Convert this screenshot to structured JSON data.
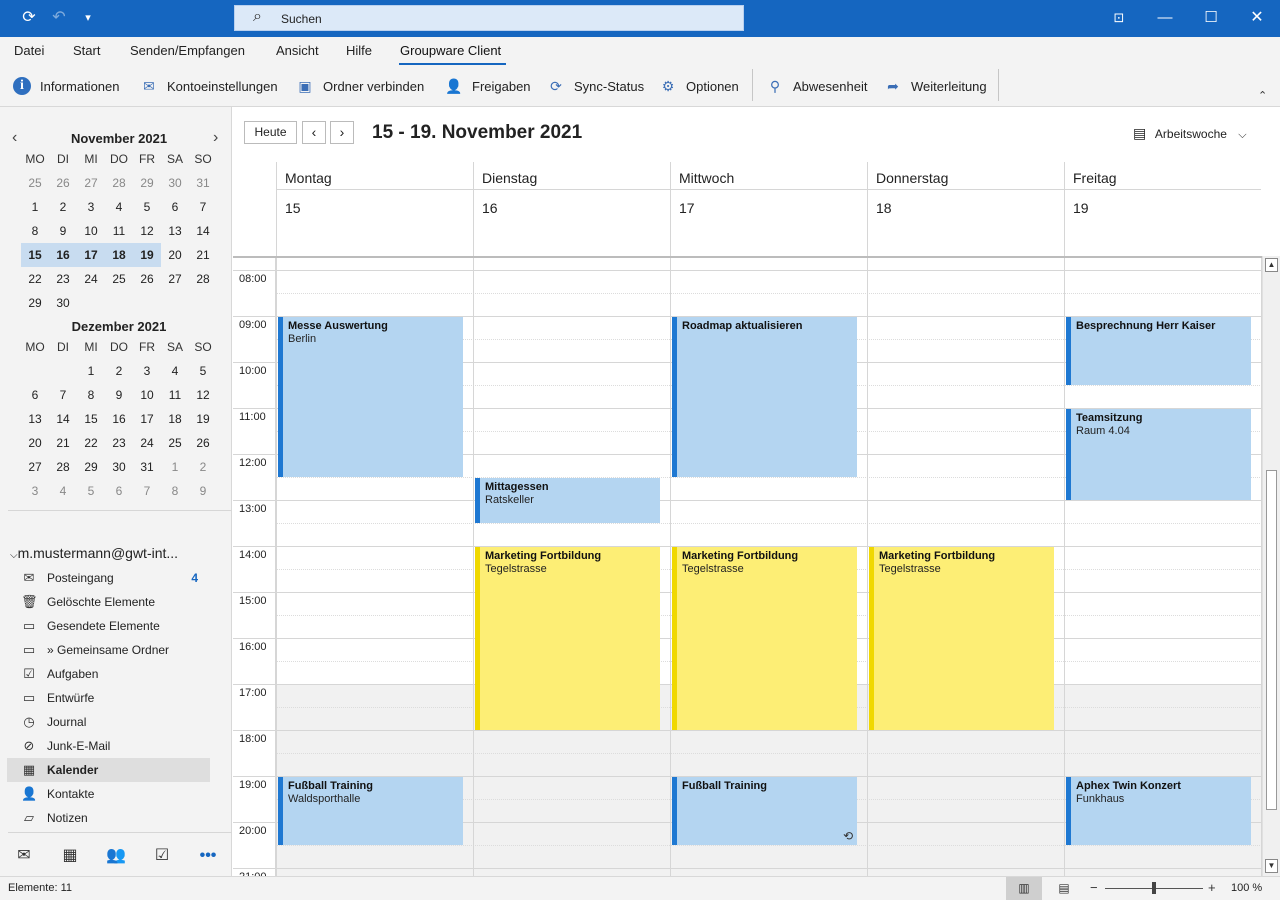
{
  "search": {
    "placeholder": "Suchen"
  },
  "menu": {
    "tabs": [
      "Datei",
      "Start",
      "Senden/Empfangen",
      "Ansicht",
      "Hilfe",
      "Groupware Client"
    ],
    "active": "Groupware Client"
  },
  "ribbon": {
    "buttons": [
      "Informationen",
      "Kontoeinstellungen",
      "Ordner verbinden",
      "Freigaben",
      "Sync-Status",
      "Optionen",
      "Abwesenheit",
      "Weiterleitung"
    ]
  },
  "mini_calendar": {
    "weekday_labels": [
      "MO",
      "DI",
      "MI",
      "DO",
      "FR",
      "SA",
      "SO"
    ],
    "november": {
      "title": "November 2021",
      "rows": [
        [
          "25",
          "26",
          "27",
          "28",
          "29",
          "30",
          "31"
        ],
        [
          "1",
          "2",
          "3",
          "4",
          "5",
          "6",
          "7"
        ],
        [
          "8",
          "9",
          "10",
          "11",
          "12",
          "13",
          "14"
        ],
        [
          "15",
          "16",
          "17",
          "18",
          "19",
          "20",
          "21"
        ],
        [
          "22",
          "23",
          "24",
          "25",
          "26",
          "27",
          "28"
        ],
        [
          "29",
          "30",
          "",
          "",
          "",
          "",
          ""
        ]
      ]
    },
    "december": {
      "title": "Dezember 2021",
      "rows": [
        [
          "",
          "",
          "1",
          "2",
          "3",
          "4",
          "5"
        ],
        [
          "6",
          "7",
          "8",
          "9",
          "10",
          "11",
          "12"
        ],
        [
          "13",
          "14",
          "15",
          "16",
          "17",
          "18",
          "19"
        ],
        [
          "20",
          "21",
          "22",
          "23",
          "24",
          "25",
          "26"
        ],
        [
          "27",
          "28",
          "29",
          "30",
          "31",
          "1",
          "2"
        ],
        [
          "3",
          "4",
          "5",
          "6",
          "7",
          "8",
          "9"
        ]
      ]
    }
  },
  "account": {
    "label": "m.mustermann@gwt-int..."
  },
  "folders": [
    {
      "name": "Posteingang",
      "icon": "inbox-icon",
      "count": "4"
    },
    {
      "name": "Gelöschte Elemente",
      "icon": "trash-icon",
      "count": ""
    },
    {
      "name": "Gesendete Elemente",
      "icon": "folder-icon",
      "count": ""
    },
    {
      "name": "» Gemeinsame Ordner",
      "icon": "folder-icon",
      "count": ""
    },
    {
      "name": "Aufgaben",
      "icon": "tasks-icon",
      "count": ""
    },
    {
      "name": "Entwürfe",
      "icon": "folder-icon",
      "count": ""
    },
    {
      "name": "Journal",
      "icon": "journal-icon",
      "count": ""
    },
    {
      "name": "Junk-E-Mail",
      "icon": "junk-icon",
      "count": ""
    },
    {
      "name": "Kalender",
      "icon": "calendar-icon",
      "count": "",
      "active": true
    },
    {
      "name": "Kontakte",
      "icon": "contacts-icon",
      "count": ""
    },
    {
      "name": "Notizen",
      "icon": "notes-icon",
      "count": ""
    }
  ],
  "calendar": {
    "today_label": "Heute",
    "range_title": "15 - 19. November 2021",
    "view_label": "Arbeitswoche",
    "days": [
      {
        "name": "Montag",
        "date": "15"
      },
      {
        "name": "Dienstag",
        "date": "16"
      },
      {
        "name": "Mittwoch",
        "date": "17"
      },
      {
        "name": "Donnerstag",
        "date": "18"
      },
      {
        "name": "Freitag",
        "date": "19"
      }
    ],
    "hours": [
      "08:00",
      "09:00",
      "10:00",
      "11:00",
      "12:00",
      "13:00",
      "14:00",
      "15:00",
      "16:00",
      "17:00",
      "18:00",
      "19:00",
      "20:00",
      "21:00"
    ],
    "events": [
      {
        "title": "Messe Auswertung",
        "location": "Berlin",
        "day": 0,
        "start": 9.0,
        "end": 12.5,
        "color": "blue"
      },
      {
        "title": "Roadmap aktualisieren",
        "location": "",
        "day": 2,
        "start": 9.0,
        "end": 12.5,
        "color": "blue"
      },
      {
        "title": "Besprechnung Herr Kaiser",
        "location": "",
        "day": 4,
        "start": 9.0,
        "end": 10.5,
        "color": "blue"
      },
      {
        "title": "Teamsitzung",
        "location": "Raum 4.04",
        "day": 4,
        "start": 11.0,
        "end": 13.0,
        "color": "blue"
      },
      {
        "title": "Mittagessen",
        "location": "Ratskeller",
        "day": 1,
        "start": 12.5,
        "end": 13.5,
        "color": "blue"
      },
      {
        "title": "Marketing Fortbildung",
        "location": "Tegelstrasse",
        "day": 1,
        "start": 14.0,
        "end": 18.0,
        "color": "yellow"
      },
      {
        "title": "Marketing Fortbildung",
        "location": "Tegelstrasse",
        "day": 2,
        "start": 14.0,
        "end": 18.0,
        "color": "yellow"
      },
      {
        "title": "Marketing Fortbildung",
        "location": "Tegelstrasse",
        "day": 3,
        "start": 14.0,
        "end": 18.0,
        "color": "yellow"
      },
      {
        "title": "Fußball Training",
        "location": "Waldsporthalle",
        "day": 0,
        "start": 19.0,
        "end": 20.5,
        "color": "blue"
      },
      {
        "title": "Fußball Training",
        "location": "",
        "day": 2,
        "start": 19.0,
        "end": 20.5,
        "color": "blue",
        "recurring": true
      },
      {
        "title": "Aphex Twin Konzert",
        "location": "Funkhaus",
        "day": 4,
        "start": 19.0,
        "end": 20.5,
        "color": "blue"
      }
    ]
  },
  "status": {
    "items_label": "Elemente: 11",
    "zoom_label": "100 %"
  },
  "colors": {
    "accent": "#1566c0",
    "event_blue": "#b4d5f1",
    "event_yellow": "#fdee75"
  }
}
